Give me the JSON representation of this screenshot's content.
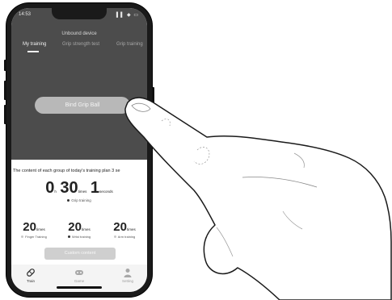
{
  "status_bar": {
    "time": "14:53",
    "icons": "▌▌ ◆ ▭"
  },
  "header": {
    "title": "Unbound device"
  },
  "tabs": [
    {
      "label": "My training",
      "active": true
    },
    {
      "label": "Grip strength test",
      "active": false
    },
    {
      "label": "Grip training",
      "active": false
    }
  ],
  "bind_button": {
    "label": "Bind Grip Ball"
  },
  "plan": {
    "text": "The content of each group of today's training plan 3 se"
  },
  "main_stat": {
    "hours": "0",
    "hours_unit": "h",
    "count": "30",
    "count_unit": "times",
    "seconds": "1",
    "seconds_unit": "seconds",
    "label": "Grip training"
  },
  "sub_stats": [
    {
      "value": "20",
      "unit": "times",
      "label": "Finger Training"
    },
    {
      "value": "20",
      "unit": "times",
      "label": "Wrist training"
    },
    {
      "value": "20",
      "unit": "times",
      "label": "Arm training"
    }
  ],
  "custom_button": {
    "label": "Custom content"
  },
  "nav": [
    {
      "label": "Train",
      "icon": "train-icon",
      "active": true
    },
    {
      "label": "Game",
      "icon": "game-controller-icon",
      "active": false
    },
    {
      "label": "Setting",
      "icon": "person-icon",
      "active": false
    }
  ],
  "colors": {
    "screen_top": "#4c4c4c",
    "bind_button": "#b8b8b8",
    "custom_button": "#cfcfcf"
  }
}
